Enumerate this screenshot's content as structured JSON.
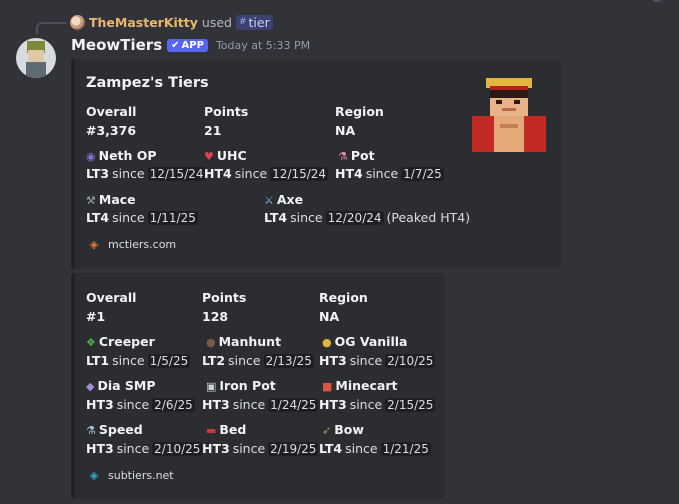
{
  "reply": {
    "username": "TheMasterKitty",
    "used_text": "used",
    "command": "tier"
  },
  "message": {
    "author": "MeowTiers",
    "badge": "APP",
    "timestamp": "Today at 5:33 PM"
  },
  "embed1": {
    "title": "Zampez's Tiers",
    "stats": [
      {
        "name": "Overall",
        "value": "#3,376"
      },
      {
        "name": "Points",
        "value": "21"
      },
      {
        "name": "Region",
        "value": "NA"
      }
    ],
    "tiers": [
      {
        "icon": "netherite-helmet-icon",
        "name": "Neth OP",
        "tier": "LT3",
        "since": "since",
        "date": "12/15/24",
        "extra": ""
      },
      {
        "icon": "heart-icon",
        "name": "UHC",
        "tier": "HT4",
        "since": "since",
        "date": "12/15/24",
        "extra": ""
      },
      {
        "icon": "potion-icon",
        "name": "Pot",
        "tier": "HT4",
        "since": "since",
        "date": "1/7/25",
        "extra": ""
      },
      {
        "icon": "mace-icon",
        "name": "Mace",
        "tier": "LT4",
        "since": "since",
        "date": "1/11/25",
        "extra": ""
      },
      {
        "icon": "axe-icon",
        "name": "Axe",
        "tier": "LT4",
        "since": "since",
        "date": "12/20/24",
        "extra": "(Peaked HT4)"
      }
    ],
    "footer": "mctiers.com",
    "accent": "#e8792b"
  },
  "embed2": {
    "stats": [
      {
        "name": "Overall",
        "value": "#1"
      },
      {
        "name": "Points",
        "value": "128"
      },
      {
        "name": "Region",
        "value": "NA"
      }
    ],
    "tiers": [
      {
        "icon": "creeper-icon",
        "name": "Creeper",
        "tier": "LT1",
        "since": "since",
        "date": "1/5/25"
      },
      {
        "icon": "manhunt-icon",
        "name": "Manhunt",
        "tier": "LT2",
        "since": "since",
        "date": "2/13/25"
      },
      {
        "icon": "og-vanilla-icon",
        "name": "OG Vanilla",
        "tier": "HT3",
        "since": "since",
        "date": "2/10/25"
      },
      {
        "icon": "dia-smp-icon",
        "name": "Dia SMP",
        "tier": "HT3",
        "since": "since",
        "date": "2/6/25"
      },
      {
        "icon": "iron-pot-icon",
        "name": "Iron Pot",
        "tier": "HT3",
        "since": "since",
        "date": "1/24/25"
      },
      {
        "icon": "minecart-icon",
        "name": "Minecart",
        "tier": "HT3",
        "since": "since",
        "date": "2/15/25"
      },
      {
        "icon": "speed-icon",
        "name": "Speed",
        "tier": "HT3",
        "since": "since",
        "date": "2/10/25"
      },
      {
        "icon": "bed-icon",
        "name": "Bed",
        "tier": "HT3",
        "since": "since",
        "date": "2/19/25"
      },
      {
        "icon": "bow-icon",
        "name": "Bow",
        "tier": "LT4",
        "since": "since",
        "date": "1/21/25"
      }
    ],
    "footer": "subtiers.net",
    "accent": "#3aa6d0"
  }
}
